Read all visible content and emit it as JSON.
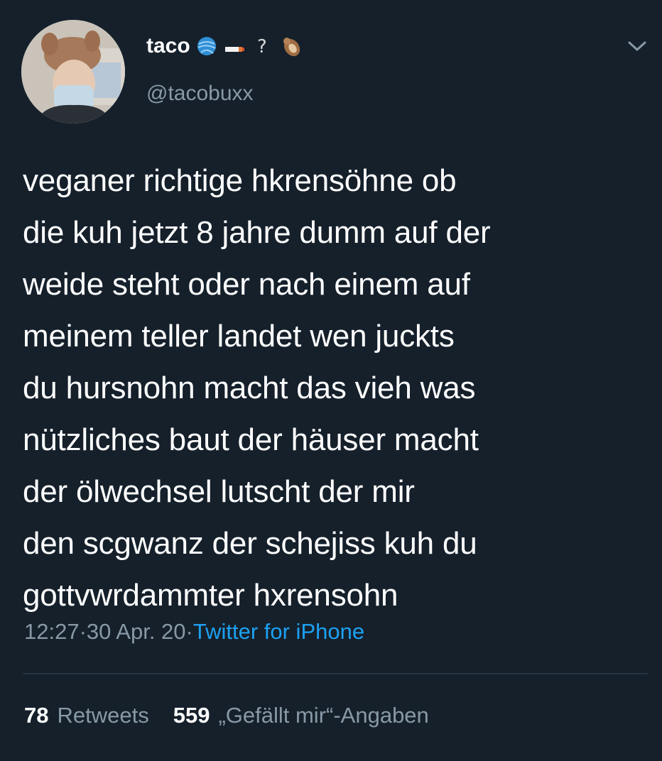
{
  "author": {
    "display_name": "taco",
    "handle": "@tacobuxx",
    "name_emojis": [
      "yarn-ball-emoji",
      "cigarette-emoji",
      "question-mark-emoji",
      "otter-emoji"
    ]
  },
  "tweet": {
    "text": "veganer richtige hkrensöhne ob\ndie kuh jetzt 8 jahre dumm auf der\nweide steht oder nach einem auf\nmeinem teller landet wen juckts\ndu hursnohn macht das vieh was\nnützliches baut der häuser macht\nder ölwechsel lutscht der mir\nden scgwanz der schejiss kuh du\ngottvwrdammter hxrensohn",
    "time": "12:27",
    "date": "30 Apr. 20",
    "separator": " · ",
    "source": "Twitter for iPhone"
  },
  "stats": {
    "retweets_count": "78",
    "retweets_label": "Retweets",
    "likes_count": "559",
    "likes_label": "„Gefällt mir“-Angaben"
  },
  "colors": {
    "background": "#15202b",
    "text": "#ffffff",
    "secondary": "#8899a6",
    "link": "#1da1f2"
  }
}
